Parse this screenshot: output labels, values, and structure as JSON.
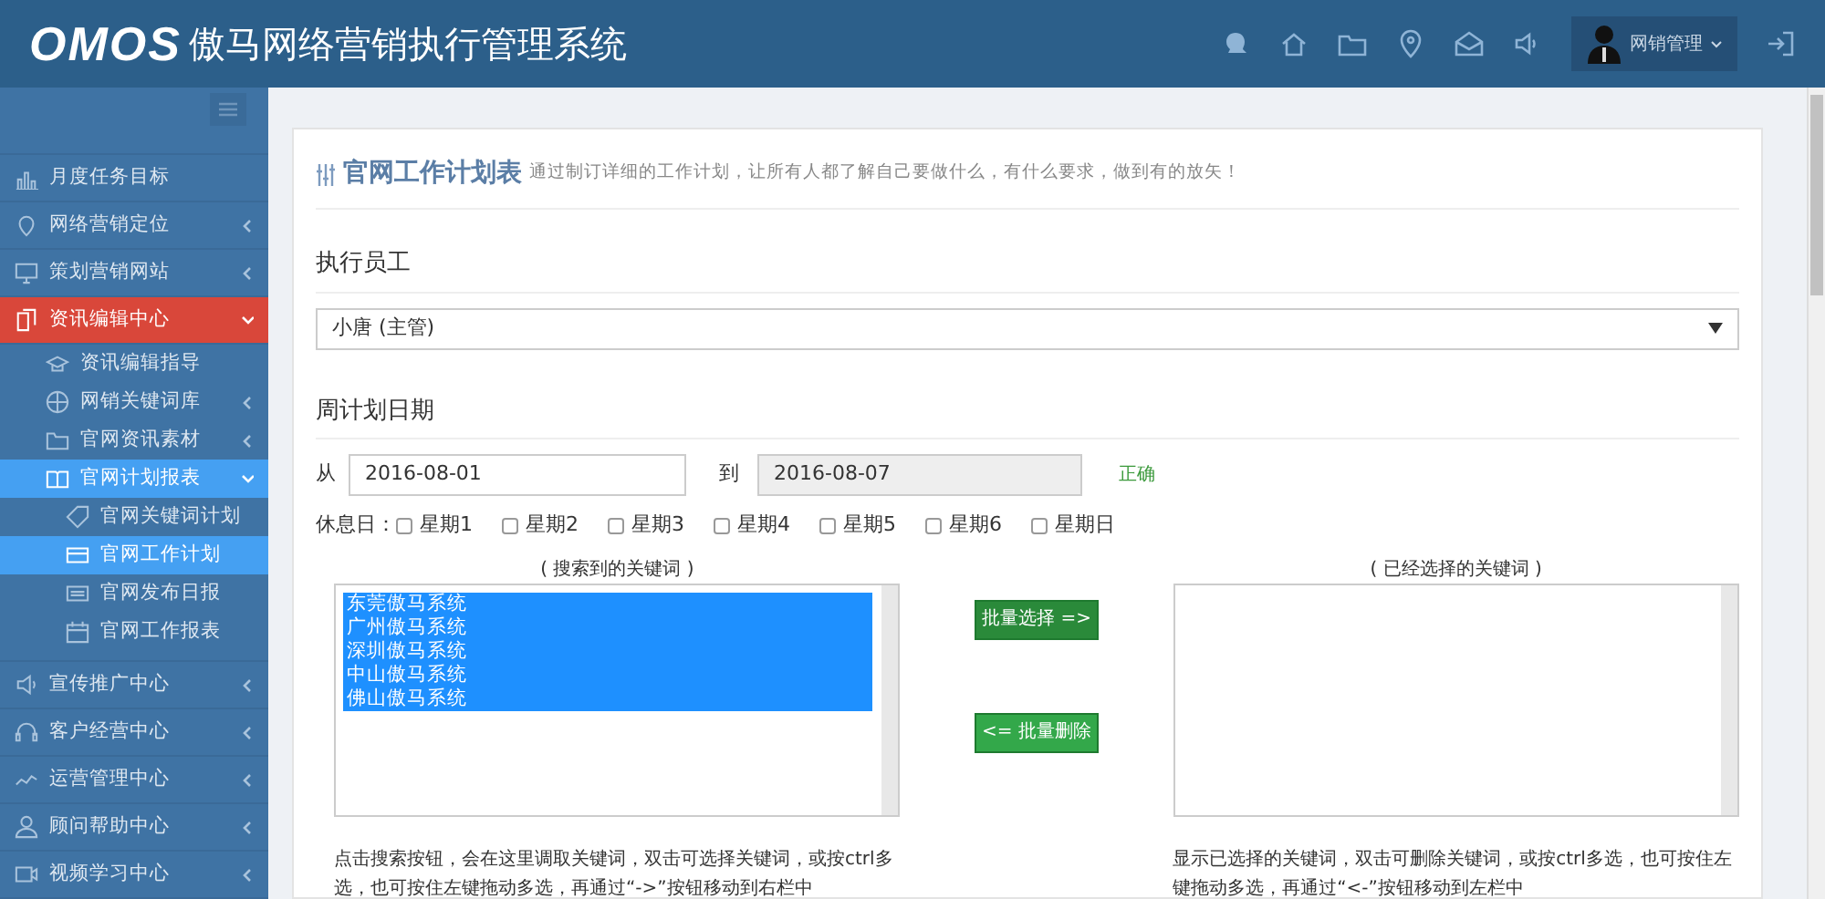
{
  "header": {
    "logo": "OMOS",
    "title": "傲马网络营销执行管理系统",
    "user": {
      "name": "网销管理"
    }
  },
  "sidebar": {
    "items": [
      {
        "label": "月度任务目标",
        "selected": false
      },
      {
        "label": "网络营销定位",
        "selected": false,
        "expanded": false
      },
      {
        "label": "策划营销网站",
        "selected": false,
        "expanded": false
      },
      {
        "label": "资讯编辑中心",
        "selected": true,
        "expanded": true,
        "children": [
          {
            "label": "资讯编辑指导",
            "selected": false
          },
          {
            "label": "网销关键词库",
            "selected": false,
            "expanded": false
          },
          {
            "label": "官网资讯素材",
            "selected": false,
            "expanded": false
          },
          {
            "label": "官网计划报表",
            "selected": true,
            "expanded": true,
            "children": [
              {
                "label": "官网关键词计划",
                "selected": false
              },
              {
                "label": "官网工作计划",
                "selected": true
              },
              {
                "label": "官网发布日报",
                "selected": false
              },
              {
                "label": "官网工作报表",
                "selected": false
              }
            ]
          }
        ]
      },
      {
        "label": "宣传推广中心",
        "selected": false,
        "expanded": false
      },
      {
        "label": "客户经营中心",
        "selected": false,
        "expanded": false
      },
      {
        "label": "运营管理中心",
        "selected": false,
        "expanded": false
      },
      {
        "label": "顾问帮助中心",
        "selected": false,
        "expanded": false
      },
      {
        "label": "视频学习中心",
        "selected": false,
        "expanded": false
      }
    ]
  },
  "page": {
    "title": "官网工作计划表",
    "subtitle": "通过制订详细的工作计划，让所有人都了解自己要做什么，有什么要求，做到有的放矢！"
  },
  "staff": {
    "heading": "执行员工",
    "value": "小唐 (主管)"
  },
  "dates": {
    "heading": "周计划日期",
    "from_label": "从",
    "from": "2016-08-01",
    "to_label": "到",
    "to": "2016-08-07",
    "to_disabled": true,
    "status": "正确"
  },
  "rest_days": {
    "label": "休息日：",
    "days": [
      {
        "label": "星期1",
        "checked": false
      },
      {
        "label": "星期2",
        "checked": false
      },
      {
        "label": "星期3",
        "checked": false
      },
      {
        "label": "星期4",
        "checked": false
      },
      {
        "label": "星期5",
        "checked": false
      },
      {
        "label": "星期6",
        "checked": false
      },
      {
        "label": "星期日",
        "checked": false
      }
    ]
  },
  "keywords": {
    "found_label": "( 搜索到的关键词 )",
    "found": [
      {
        "text": "东莞傲马系统",
        "selected": true
      },
      {
        "text": "广州傲马系统",
        "selected": true
      },
      {
        "text": "深圳傲马系统",
        "selected": true
      },
      {
        "text": "中山傲马系统",
        "selected": true
      },
      {
        "text": "佛山傲马系统",
        "selected": true
      }
    ],
    "add_button": "批量选择 =>",
    "remove_button": "<= 批量删除",
    "chosen_label": "( 已经选择的关键词 )",
    "found_help": "点击搜索按钮，会在这里调取关键词，双击可选择关键词，或按ctrl多选，也可按住左键拖动多选，再通过“->”按钮移动到右栏中",
    "chosen_help": "显示已选择的关键词，双击可删除关键词，或按ctrl多选，也可按住左键拖动多选，再通过“<-”按钮移动到左栏中"
  }
}
